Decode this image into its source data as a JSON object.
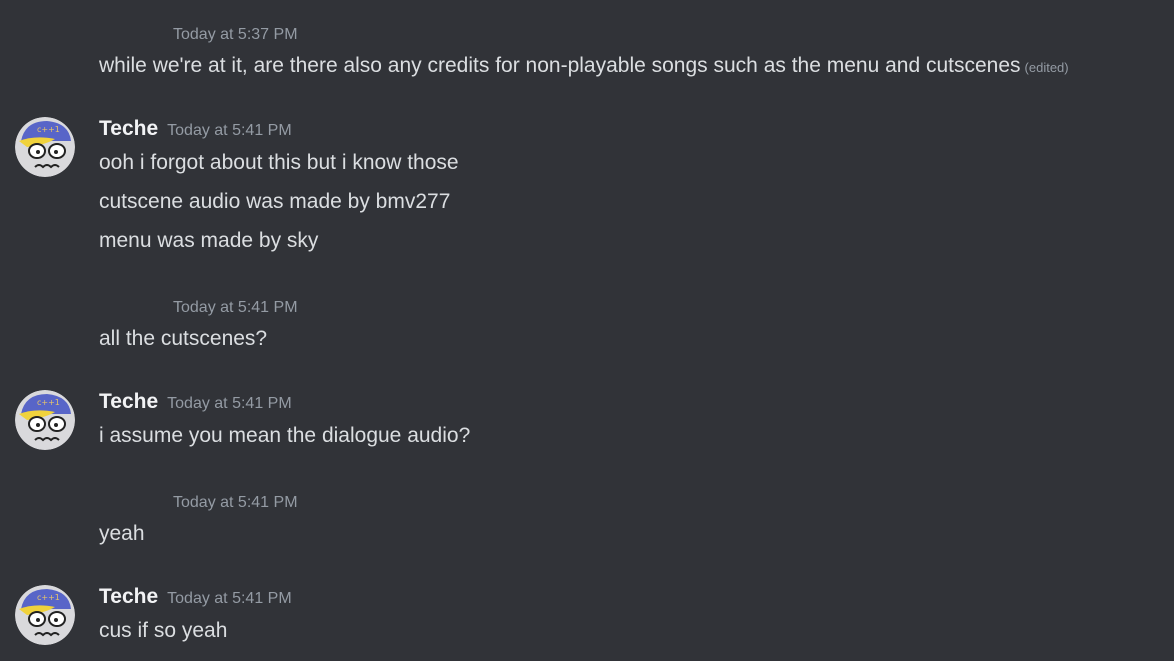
{
  "messages": [
    {
      "type": "continuation",
      "timestamp": "Today at 5:37 PM",
      "lines": [
        "while we're at it, are there also any credits for non-playable songs such as the menu and cutscenes"
      ],
      "edited_label": "(edited)"
    },
    {
      "type": "full",
      "author": "Teche",
      "timestamp": "Today at 5:41 PM",
      "lines": [
        "ooh i forgot about this but i know those",
        "cutscene audio was made by bmv277",
        "menu was made by sky"
      ]
    },
    {
      "type": "continuation",
      "timestamp": "Today at 5:41 PM",
      "lines": [
        "all the cutscenes?"
      ]
    },
    {
      "type": "full",
      "author": "Teche",
      "timestamp": "Today at 5:41 PM",
      "lines": [
        "i assume you mean the dialogue audio?"
      ]
    },
    {
      "type": "continuation",
      "timestamp": "Today at 5:41 PM",
      "lines": [
        "yeah"
      ]
    },
    {
      "type": "full",
      "author": "Teche",
      "timestamp": "Today at 5:41 PM",
      "lines": [
        "cus if so yeah"
      ]
    }
  ],
  "avatar": {
    "icon": "teche-avatar-icon",
    "cap_color": "#5865c8",
    "hair_color": "#f0d23c",
    "face_color": "#d9d9dc"
  },
  "colors": {
    "background": "#313338",
    "author": "#f2f3f5",
    "text": "#dbdee1",
    "muted": "#949ba4"
  }
}
